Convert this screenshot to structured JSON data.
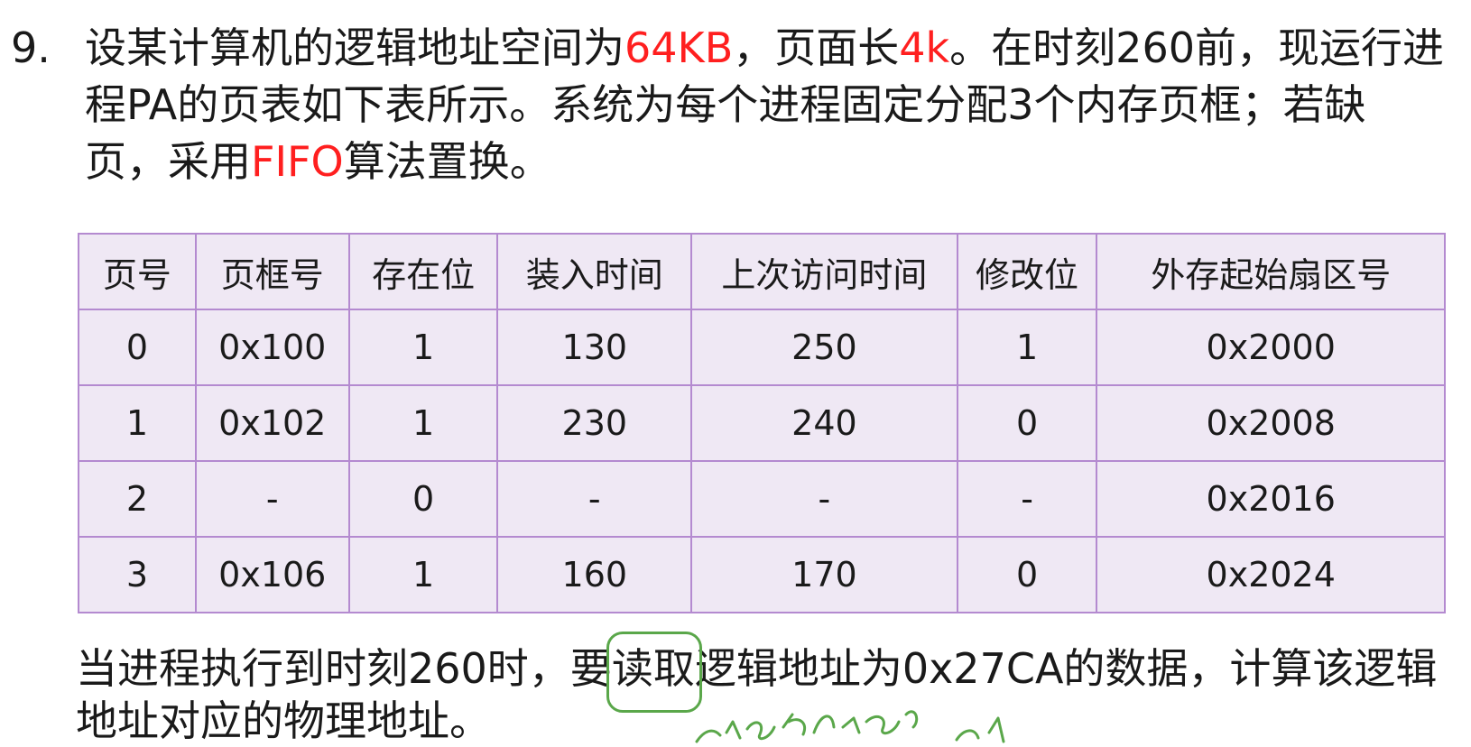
{
  "problem": {
    "number": "9.",
    "segments": [
      {
        "text": "设某计算机的逻辑地址空间为",
        "color": "normal"
      },
      {
        "text": "64KB",
        "color": "red"
      },
      {
        "text": "，页面长",
        "color": "normal"
      },
      {
        "text": "4k",
        "color": "red"
      },
      {
        "text": "。在时刻260前，现运行进程PA的页表如下表所示。系统为每个进程固定分配3个内存页框；若缺页，采用",
        "color": "normal"
      },
      {
        "text": "FIFO",
        "color": "red"
      },
      {
        "text": "算法置换。",
        "color": "normal"
      }
    ],
    "highlight_color": "#ff1f1f"
  },
  "table": {
    "headers": [
      "页号",
      "页框号",
      "存在位",
      "装入时间",
      "上次访问时间",
      "修改位",
      "外存起始扇区号"
    ],
    "rows": [
      [
        "0",
        "0x100",
        "1",
        "130",
        "250",
        "1",
        "0x2000"
      ],
      [
        "1",
        "0x102",
        "1",
        "230",
        "240",
        "0",
        "0x2008"
      ],
      [
        "2",
        "-",
        "0",
        "-",
        "-",
        "-",
        "0x2016"
      ],
      [
        "3",
        "0x106",
        "1",
        "160",
        "170",
        "0",
        "0x2024"
      ]
    ],
    "fill_color": "#efe8f4",
    "border_color": "#b48ad0"
  },
  "question": {
    "before": "当进程执行到时刻260时，要",
    "highlighted": "读取",
    "after": "逻辑地址为0x27CA的数据，计算该逻辑地址对应的物理地址。",
    "annotation_color": "#5aa74a"
  }
}
